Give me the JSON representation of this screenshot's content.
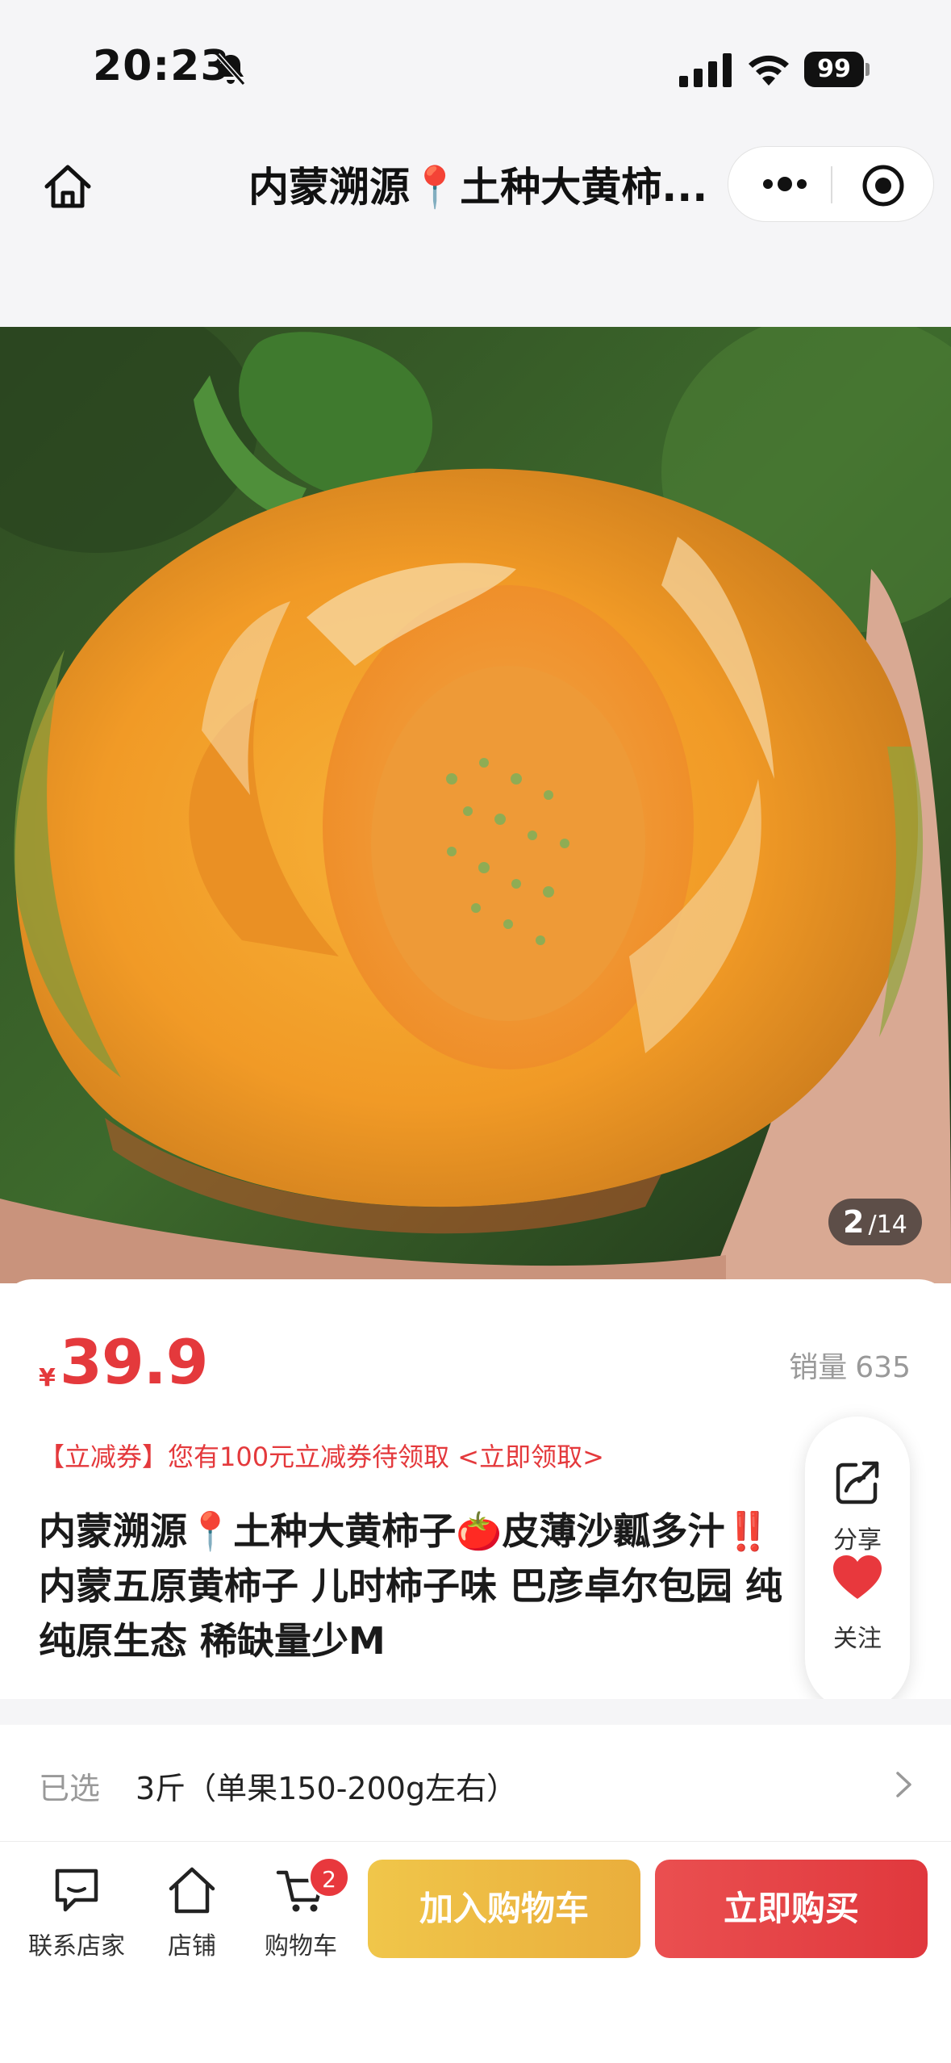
{
  "status_bar": {
    "time": "20:23",
    "battery": "99",
    "icons": [
      "bell-slash-icon",
      "cellular-signal-icon",
      "wifi-icon",
      "battery-icon"
    ]
  },
  "nav": {
    "title": "内蒙溯源📍土种大黄柿...",
    "icons": [
      "home-icon",
      "more-icon",
      "record-icon"
    ]
  },
  "gallery": {
    "current": "2",
    "total": "/14"
  },
  "product": {
    "currency": "¥",
    "price": "39.9",
    "sales_label": "销量",
    "sales_count": "635",
    "coupon": "【立减券】您有100元立减券待领取 <立即领取>",
    "title_lines": [
      "内蒙溯源📍土种大黄柿子🍅皮薄沙瓤多汁‼️",
      "内蒙五原黄柿子 儿时柿子味 巴彦卓尔包园 纯",
      "纯原生态 稀缺量少M"
    ]
  },
  "side_actions": {
    "share_label": "分享",
    "follow_label": "关注",
    "heart_color": "#e8383d"
  },
  "sku": {
    "label": "已选",
    "value": "3斤（单果150-200g左右）"
  },
  "bottom_bar": {
    "contact_label": "联系店家",
    "store_label": "店铺",
    "cart_label": "购物车",
    "cart_badge": "2",
    "add_to_cart": "加入购物车",
    "buy_now": "立即购买"
  },
  "colors": {
    "accent_red": "#e4393c",
    "add_button": "#eebc45",
    "buy_button": "#e5403f",
    "nav_background": "#f5f5f7"
  }
}
